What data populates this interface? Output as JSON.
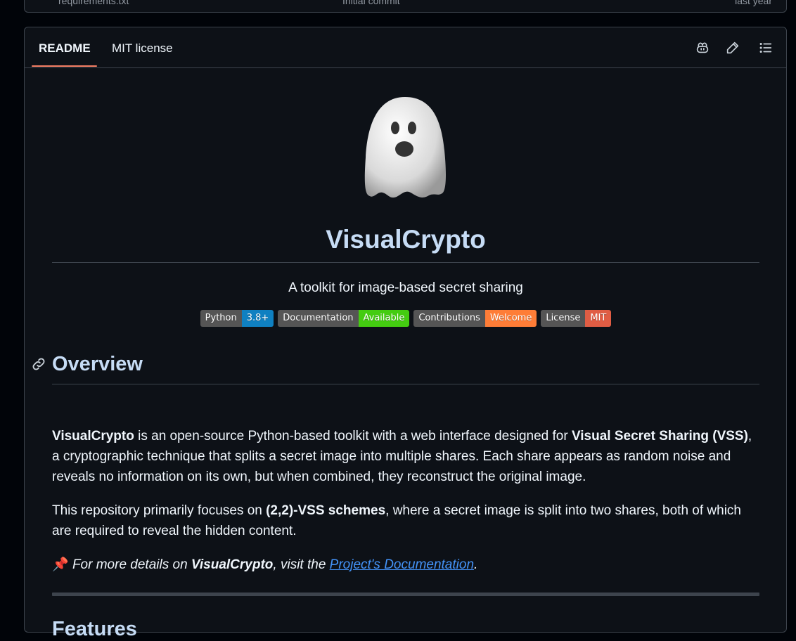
{
  "file_row": {
    "name": "requirements.txt",
    "message": "Initial commit",
    "time": "last year"
  },
  "tabs": {
    "readme": "README",
    "license": "MIT license"
  },
  "toolbar": {
    "copilot": "copilot-icon",
    "edit": "pencil-icon",
    "outline": "list-icon"
  },
  "readme": {
    "title": "VisualCrypto",
    "subtitle": "A toolkit for image-based secret sharing",
    "badges": [
      {
        "label": "Python",
        "value": "3.8+",
        "color": "#0f80c1"
      },
      {
        "label": "Documentation",
        "value": "Available",
        "color": "#4c1"
      },
      {
        "label": "Contributions",
        "value": "Welcome",
        "color": "#fe7d37"
      },
      {
        "label": "License",
        "value": "MIT",
        "color": "#e05d44"
      }
    ],
    "overview": {
      "heading": "Overview",
      "p1_bold1": "VisualCrypto",
      "p1_text1": " is an open-source Python-based toolkit with a web interface designed for ",
      "p1_bold2": "Visual Secret Sharing (VSS)",
      "p1_text2": ", a cryptographic technique that splits a secret image into multiple shares. Each share appears as random noise and reveals no information on its own, but when combined, they reconstruct the original image.",
      "p2_text1": "This repository primarily focuses on ",
      "p2_bold": "(2,2)-VSS schemes",
      "p2_text2": ", where a secret image is split into two shares, both of which are required to reveal the hidden content.",
      "p3_emoji": "📌",
      "p3_text1": " For more details on ",
      "p3_bold": "VisualCrypto",
      "p3_text2": ", visit the ",
      "p3_link": "Project's Documentation",
      "p3_text3": "."
    },
    "features_heading": "Features"
  }
}
